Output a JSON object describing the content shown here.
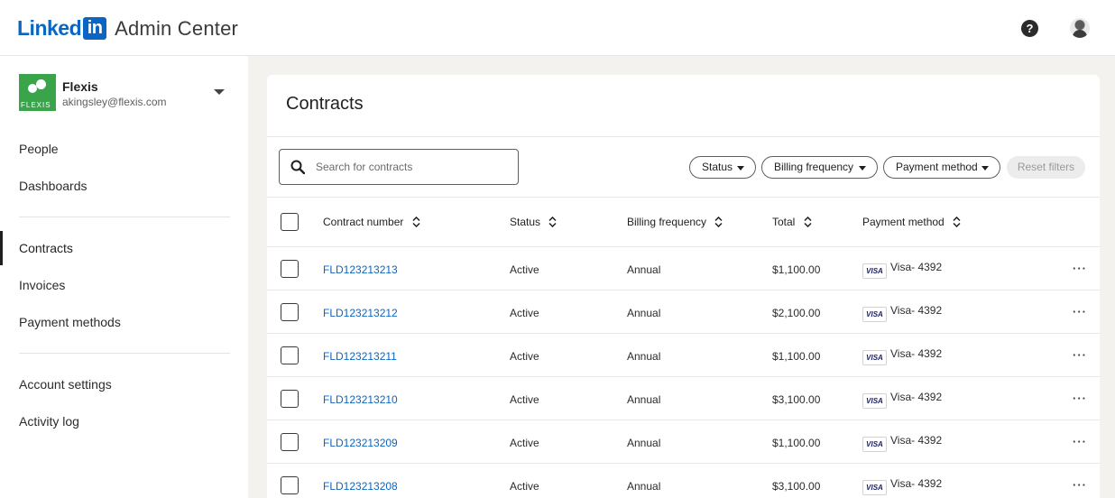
{
  "header": {
    "logo_word": "Linked",
    "logo_box": "in",
    "app_name": "Admin Center",
    "help_label": "?"
  },
  "org": {
    "name": "Flexis",
    "email": "akingsley@flexis.com",
    "logo_tag": "FLEXIS"
  },
  "nav": {
    "group1": [
      "People",
      "Dashboards"
    ],
    "group2": [
      "Contracts",
      "Invoices",
      "Payment methods"
    ],
    "group3": [
      "Account settings",
      "Activity log"
    ],
    "active": "Contracts"
  },
  "main": {
    "title": "Contracts",
    "search_placeholder": "Search for contracts",
    "filters": [
      "Status",
      "Billing frequency",
      "Payment method"
    ],
    "reset_label": "Reset filters",
    "columns": [
      "Contract number",
      "Status",
      "Billing frequency",
      "Total",
      "Payment method"
    ],
    "card_brand": "VISA",
    "more_label": "···",
    "rows": [
      {
        "number": "FLD123213213",
        "status": "Active",
        "billing": "Annual",
        "total": "$1,100.00",
        "payment": "Visa- 4392"
      },
      {
        "number": "FLD123213212",
        "status": "Active",
        "billing": "Annual",
        "total": "$2,100.00",
        "payment": "Visa- 4392"
      },
      {
        "number": "FLD123213211",
        "status": "Active",
        "billing": "Annual",
        "total": "$1,100.00",
        "payment": "Visa- 4392"
      },
      {
        "number": "FLD123213210",
        "status": "Active",
        "billing": "Annual",
        "total": "$3,100.00",
        "payment": "Visa- 4392"
      },
      {
        "number": "FLD123213209",
        "status": "Active",
        "billing": "Annual",
        "total": "$1,100.00",
        "payment": "Visa- 4392"
      },
      {
        "number": "FLD123213208",
        "status": "Active",
        "billing": "Annual",
        "total": "$3,100.00",
        "payment": "Visa- 4392"
      }
    ]
  },
  "colors": {
    "brand": "#0a66c2",
    "org_green": "#3aa44a",
    "page_bg": "#f3f2ef"
  }
}
